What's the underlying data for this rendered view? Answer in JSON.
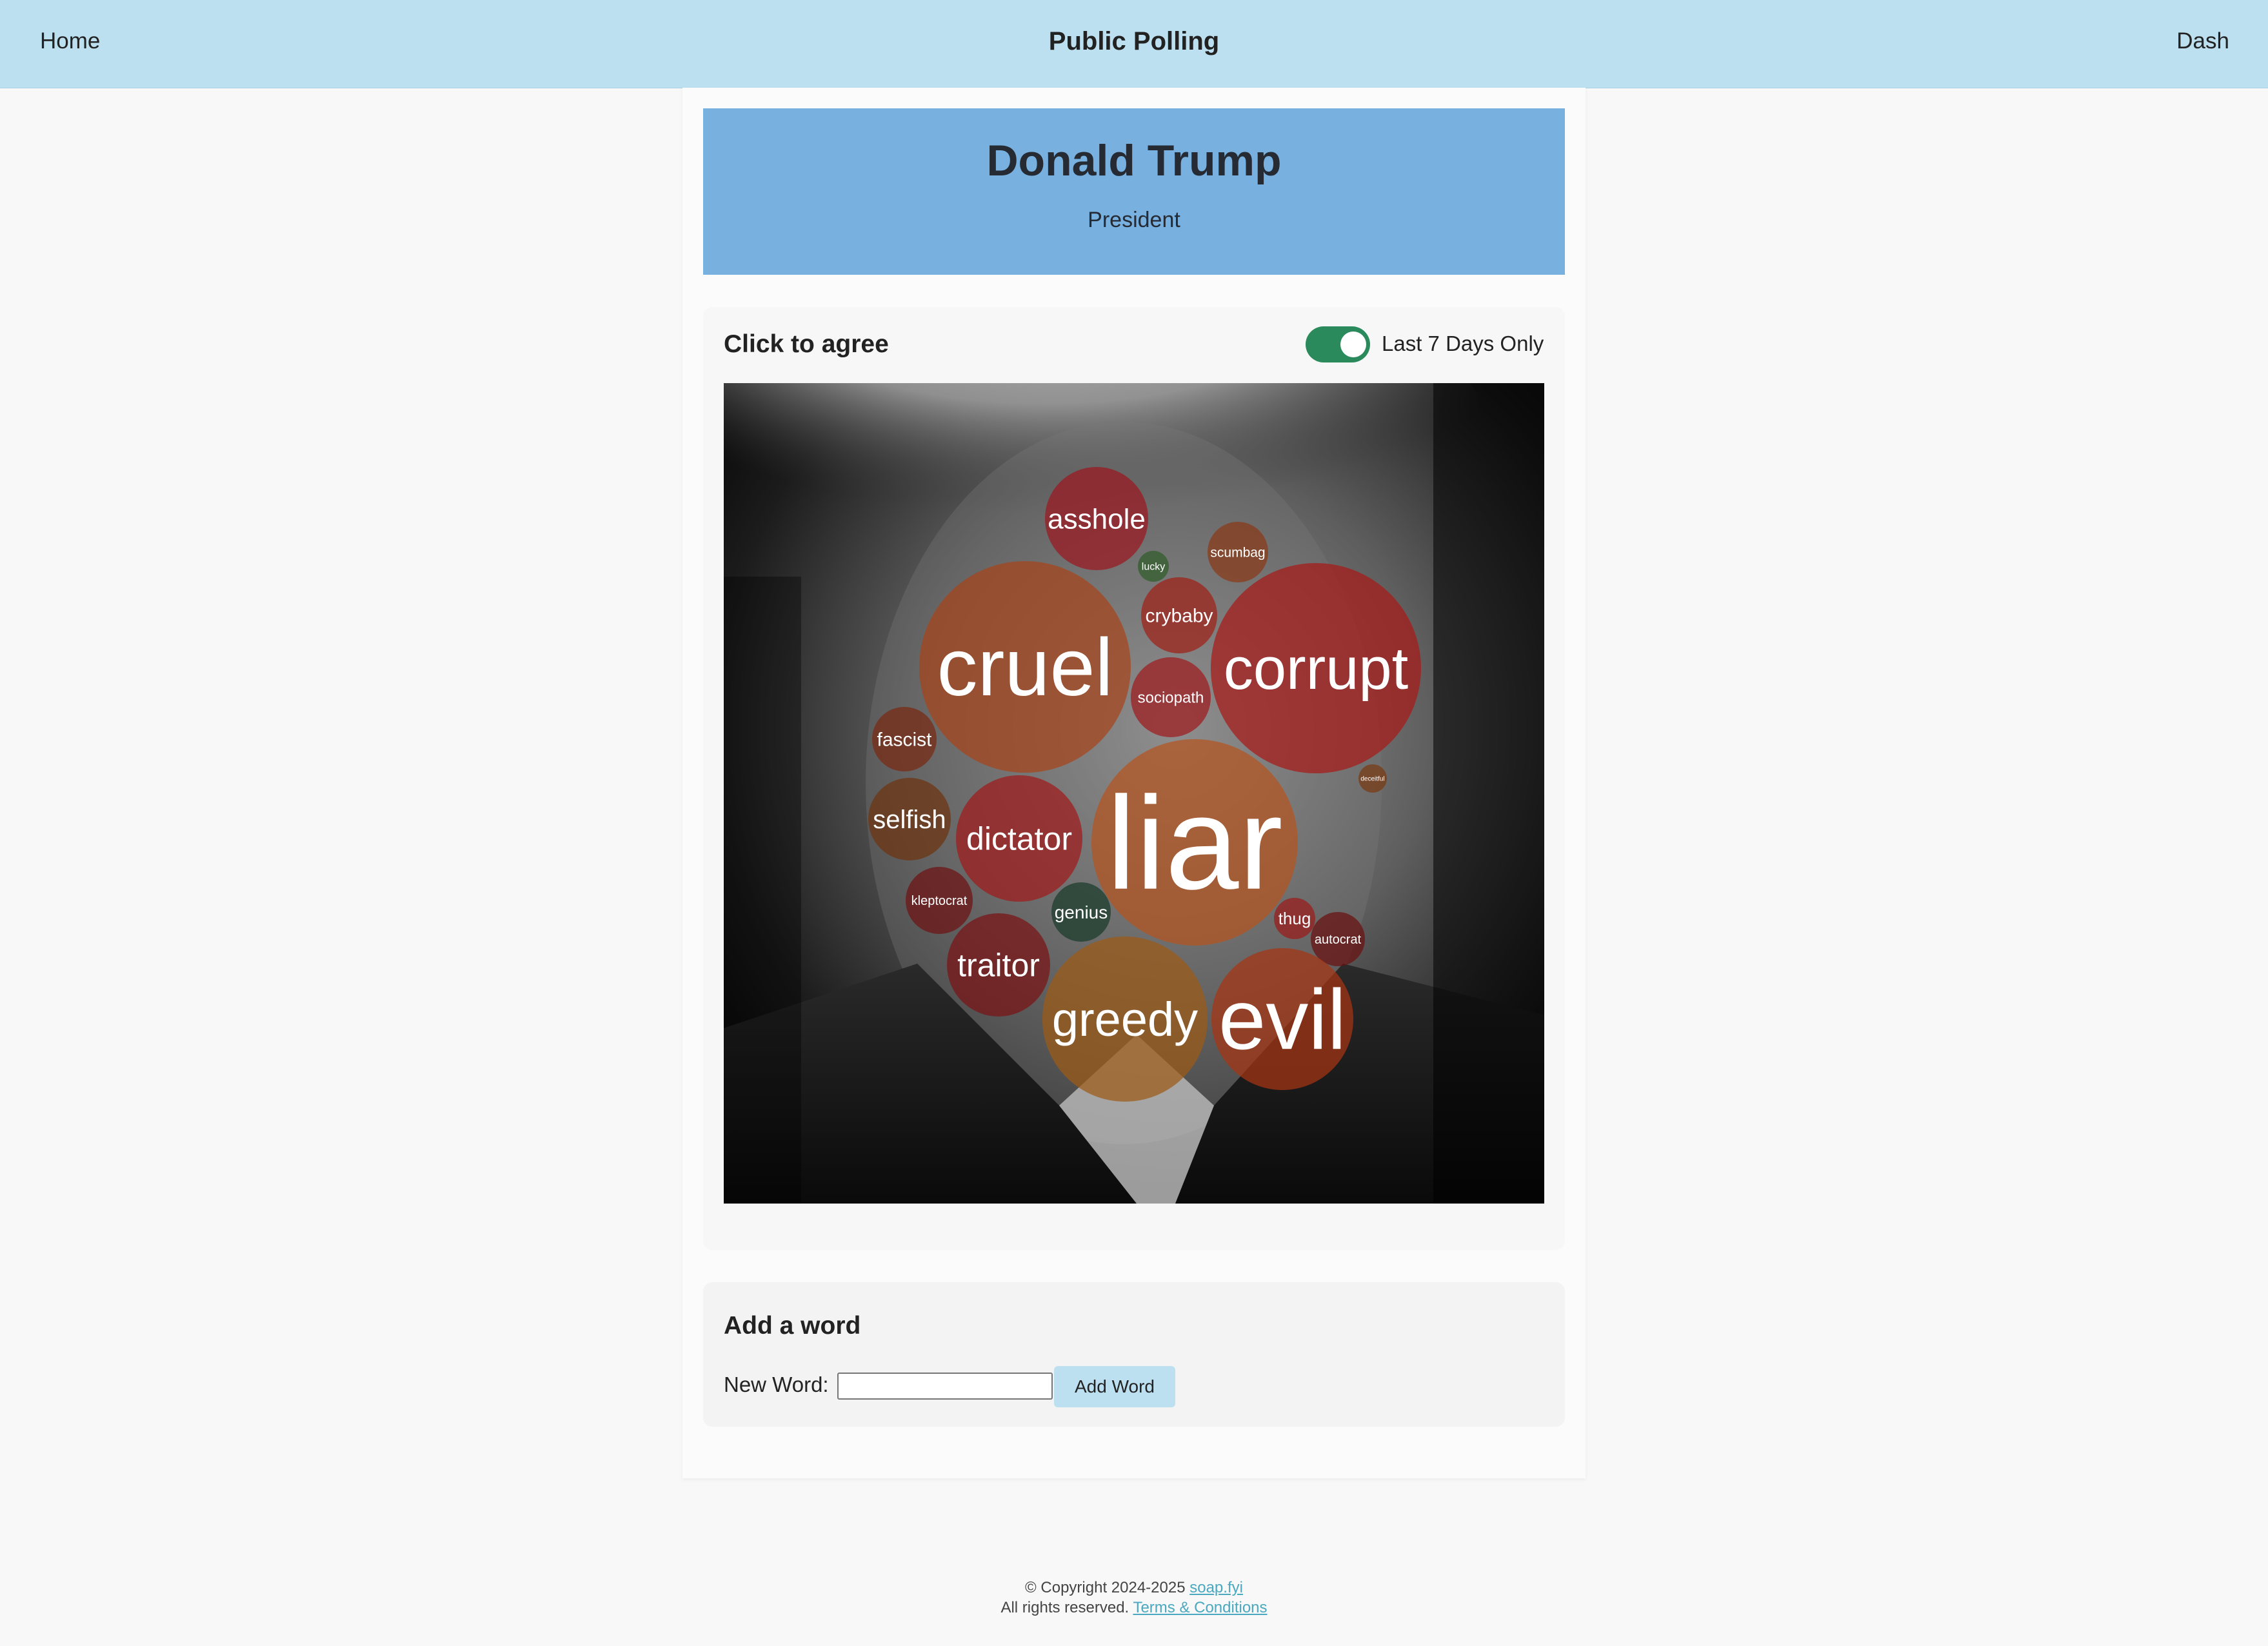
{
  "nav": {
    "home": "Home",
    "title": "Public Polling",
    "dash": "Dash"
  },
  "person": {
    "name": "Donald Trump",
    "role": "President"
  },
  "agree": {
    "title": "Click to agree",
    "toggle_label": "Last 7 Days Only",
    "toggle_on": true
  },
  "words": [
    {
      "word": "asshole",
      "color": "#9a1820"
    },
    {
      "word": "lucky",
      "color": "#2f5d2a"
    },
    {
      "word": "scumbag",
      "color": "#8a3a18"
    },
    {
      "word": "crybaby",
      "color": "#a02018"
    },
    {
      "word": "cruel",
      "color": "#a8441a"
    },
    {
      "word": "corrupt",
      "color": "#a81a18"
    },
    {
      "word": "sociopath",
      "color": "#9e1a1e"
    },
    {
      "word": "fascist",
      "color": "#7a2a12"
    },
    {
      "word": "deceitful",
      "color": "#7a3a12"
    },
    {
      "word": "selfish",
      "color": "#6e3410"
    },
    {
      "word": "dictator",
      "color": "#a01a1a"
    },
    {
      "word": "liar",
      "color": "#b5541e"
    },
    {
      "word": "kleptocrat",
      "color": "#6e1212"
    },
    {
      "word": "genius",
      "color": "#1a3a2a"
    },
    {
      "word": "thug",
      "color": "#9a1a1a"
    },
    {
      "word": "autocrat",
      "color": "#6a1010"
    },
    {
      "word": "traitor",
      "color": "#7a1414"
    },
    {
      "word": "greedy",
      "color": "#9e5a16"
    },
    {
      "word": "evil",
      "color": "#a83414"
    }
  ],
  "add": {
    "title": "Add a word",
    "label": "New Word:",
    "input_value": "",
    "button": "Add Word"
  },
  "footer": {
    "copyright": "© Copyright 2024-2025",
    "site": "soap.fyi",
    "rights": "All rights reserved.",
    "terms": "Terms & Conditions"
  },
  "colors": {
    "nav_bg": "#bde0f0",
    "header_bg": "#78b0df",
    "toggle_on": "#2a8a5c"
  }
}
